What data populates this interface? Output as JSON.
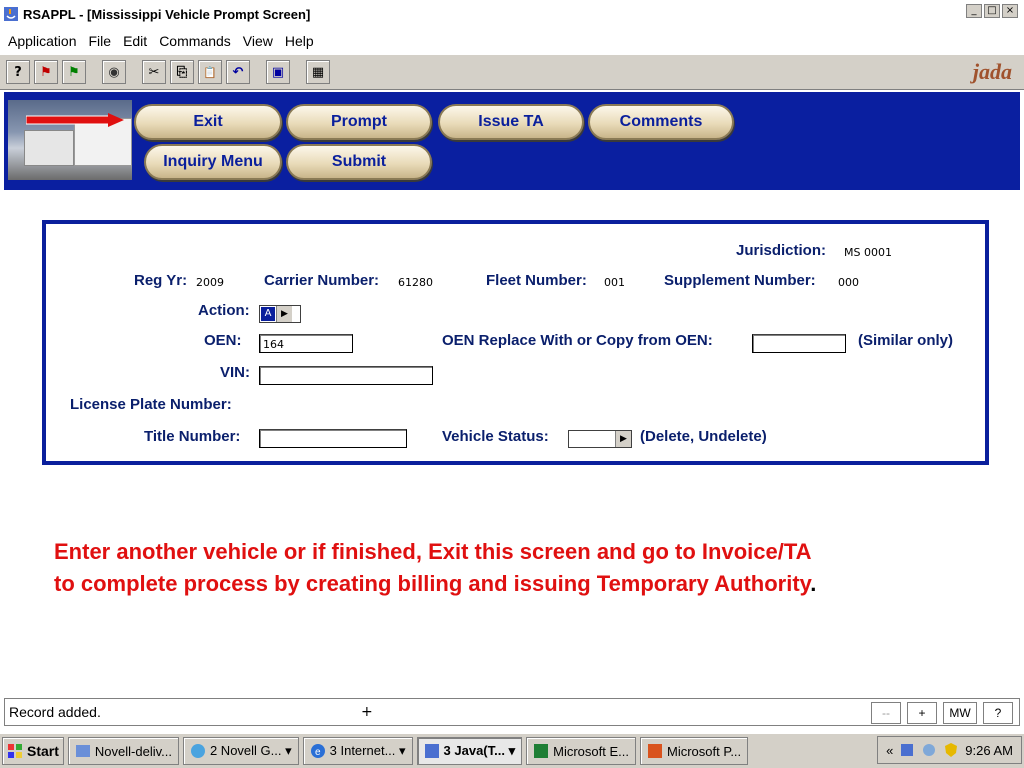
{
  "window": {
    "title": "RSAPPL - [Mississippi Vehicle Prompt Screen]",
    "controls": [
      "_",
      "□",
      "×"
    ]
  },
  "menu": [
    "Application",
    "File",
    "Edit",
    "Commands",
    "View",
    "Help"
  ],
  "toolbar": {
    "icons": [
      "help-icon",
      "flag-icon",
      "flag2-icon",
      "view-icon",
      "cut-icon",
      "copy-icon",
      "paste-icon",
      "undo-icon",
      "save-icon",
      "calculator-icon"
    ],
    "glyphs": [
      "?",
      "⚑",
      "⚑",
      "◉",
      "✂",
      "⎘",
      "📋",
      "↶",
      "▣",
      "▦"
    ],
    "logo": "jada"
  },
  "nav": {
    "exit": "Exit",
    "prompt": "Prompt",
    "issue_ta": "Issue TA",
    "comments": "Comments",
    "inquiry_menu": "Inquiry Menu",
    "submit": "Submit"
  },
  "form": {
    "jurisdiction_label": "Jurisdiction:",
    "jurisdiction_value": "MS  0001",
    "reg_yr_label": "Reg Yr:",
    "reg_yr_value": "2009",
    "carrier_label": "Carrier Number:",
    "carrier_value": "61280",
    "fleet_label": "Fleet Number:",
    "fleet_value": "001",
    "supplement_label": "Supplement Number:",
    "supplement_value": "000",
    "action_label": "Action:",
    "action_value": "A",
    "oen_label": "OEN:",
    "oen_value": "164",
    "oen_replace_label": "OEN Replace With or  Copy from OEN:",
    "oen_replace_value": "",
    "similar_only": "(Similar only)",
    "vin_label": "VIN:",
    "vin_value": "",
    "license_plate_label": "License Plate Number:",
    "title_number_label": "Title Number:",
    "title_number_value": "",
    "vehicle_status_label": "Vehicle Status:",
    "vehicle_status_hint": "(Delete, Undelete)"
  },
  "instruction": {
    "line1": "Enter another vehicle or if finished, Exit this screen and go to Invoice/TA",
    "line2": "to complete process by creating billing and issuing Temporary Authority",
    "end": "."
  },
  "status": {
    "message": "Record added.",
    "marker": "+",
    "buttons": [
      "--",
      "+",
      "MW",
      "?"
    ]
  },
  "taskbar": {
    "start": "Start",
    "tasks": [
      "Novell-deliv...",
      "2 Novell G... ▾",
      "3 Internet... ▾",
      "3 Java(T... ▾",
      "Microsoft E...",
      "Microsoft P..."
    ],
    "tray_chevron": "«",
    "clock": "9:26 AM"
  },
  "colors": {
    "brand_blue": "#0a1f9c",
    "instruction_red": "#e01010",
    "button_tan": "#e9dbb9"
  }
}
